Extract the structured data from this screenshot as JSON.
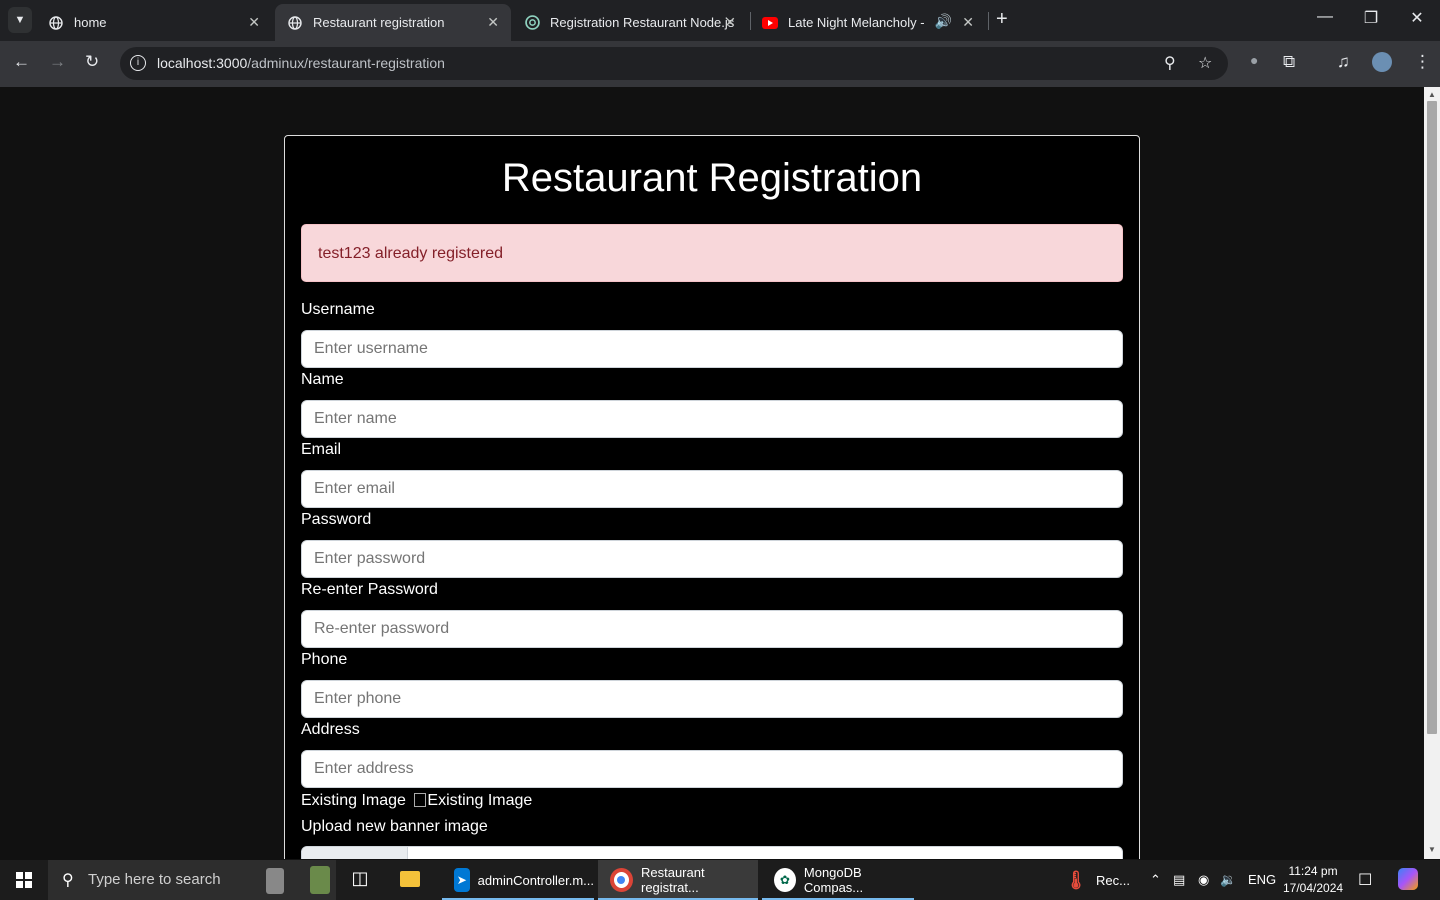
{
  "browser": {
    "tabs": [
      {
        "label": "home",
        "icon": "globe-icon"
      },
      {
        "label": "Restaurant registration",
        "icon": "globe-icon"
      },
      {
        "label": "Registration Restaurant Node.js",
        "icon": "chatgpt-icon"
      },
      {
        "label": "Late Night Melancholy - (EA",
        "icon": "youtube-icon"
      }
    ],
    "url_host": "localhost:3000",
    "url_path": "/adminux/restaurant-registration"
  },
  "page": {
    "title": "Restaurant Registration",
    "alert": "test123 already registered",
    "fields": [
      {
        "label": "Username",
        "placeholder": "Enter username"
      },
      {
        "label": "Name",
        "placeholder": "Enter name"
      },
      {
        "label": "Email",
        "placeholder": "Enter email"
      },
      {
        "label": "Password",
        "placeholder": "Enter password"
      },
      {
        "label": "Re-enter Password",
        "placeholder": "Re-enter password"
      },
      {
        "label": "Phone",
        "placeholder": "Enter phone"
      },
      {
        "label": "Address",
        "placeholder": "Enter address"
      }
    ],
    "existing_image_label": "Existing Image",
    "existing_image_alt": "Existing Image",
    "upload_label": "Upload new banner image"
  },
  "taskbar": {
    "search_placeholder": "Type here to search",
    "apps": [
      {
        "label": "adminController.m...",
        "icon": "vscode-icon",
        "color": "#0078d4"
      },
      {
        "label": "Restaurant registrat...",
        "icon": "chrome-icon",
        "color": "#4285f4"
      },
      {
        "label": "MongoDB Compas...",
        "icon": "mongodb-icon",
        "color": "#00684a"
      }
    ],
    "rec_label": "Rec...",
    "language": "ENG",
    "time": "11:24 pm",
    "date": "17/04/2024"
  }
}
